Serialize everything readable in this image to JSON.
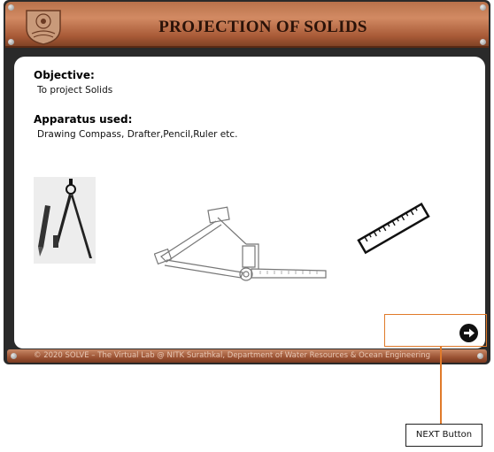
{
  "header": {
    "title": "PROJECTION OF SOLIDS",
    "logo_icon": "institute-crest-logo"
  },
  "objective": {
    "heading": "Objective:",
    "text": "To project Solids"
  },
  "apparatus": {
    "heading": "Apparatus used:",
    "text": "Drawing Compass, Drafter,Pencil,Ruler etc."
  },
  "illustrations": [
    "compass-pencil-icon",
    "drafter-icon",
    "ruler-icon"
  ],
  "footer": {
    "text": "© 2020 SOLVE – The Virtual Lab @ NITK Surathkal, Department of Water Resources & Ocean Engineering"
  },
  "next_button": {
    "icon": "arrow-right-icon"
  },
  "annotation": {
    "label": "NEXT Button"
  },
  "colors": {
    "header": "#b8714a",
    "frame": "#2a2a2a",
    "annotation": "#e07a2a"
  }
}
